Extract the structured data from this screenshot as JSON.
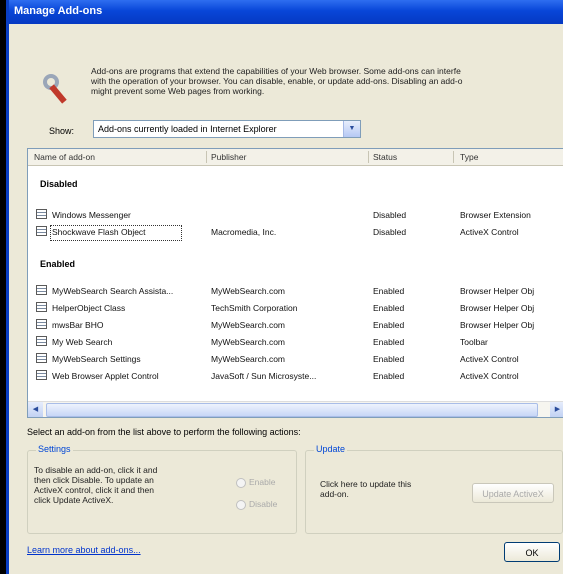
{
  "window": {
    "title": "Manage Add-ons"
  },
  "description": "Add-ons are programs that extend the capabilities of your Web browser. Some add-ons can interfe\nwith the operation of your browser. You can disable, enable, or update add-ons. Disabling an add-o\nmight prevent some Web pages from working.",
  "show": {
    "label": "Show:",
    "value": "Add-ons currently loaded in Internet Explorer"
  },
  "columns": [
    "Name of add-on",
    "Publisher",
    "Status",
    "Type"
  ],
  "groups": [
    {
      "label": "Disabled",
      "rows": [
        {
          "name": "Windows Messenger",
          "publisher": "",
          "status": "Disabled",
          "type": "Browser Extension"
        },
        {
          "name": "Shockwave Flash Object",
          "publisher": "Macromedia, Inc.",
          "status": "Disabled",
          "type": "ActiveX Control"
        }
      ]
    },
    {
      "label": "Enabled",
      "rows": [
        {
          "name": "MyWebSearch Search Assista...",
          "publisher": "MyWebSearch.com",
          "status": "Enabled",
          "type": "Browser Helper Obj"
        },
        {
          "name": "HelperObject Class",
          "publisher": "TechSmith Corporation",
          "status": "Enabled",
          "type": "Browser Helper Obj"
        },
        {
          "name": "mwsBar BHO",
          "publisher": "MyWebSearch.com",
          "status": "Enabled",
          "type": "Browser Helper Obj"
        },
        {
          "name": "My Web Search",
          "publisher": "MyWebSearch.com",
          "status": "Enabled",
          "type": "Toolbar"
        },
        {
          "name": "MyWebSearch Settings",
          "publisher": "MyWebSearch.com",
          "status": "Enabled",
          "type": "ActiveX Control"
        },
        {
          "name": "Web Browser Applet Control",
          "publisher": "JavaSoft / Sun Microsyste...",
          "status": "Enabled",
          "type": "ActiveX Control"
        }
      ]
    }
  ],
  "actions_text": "Select an add-on from the list above to perform the following actions:",
  "settings": {
    "label": "Settings",
    "text": "To disable an add-on, click it and\nthen click Disable. To update an\nActiveX control, click it and then\nclick Update ActiveX.",
    "enable": "Enable",
    "disable": "Disable"
  },
  "update": {
    "label": "Update",
    "text": "Click here to update this\nadd-on.",
    "button": "Update ActiveX"
  },
  "learn_more": "Learn more about add-ons...",
  "ok": "OK"
}
